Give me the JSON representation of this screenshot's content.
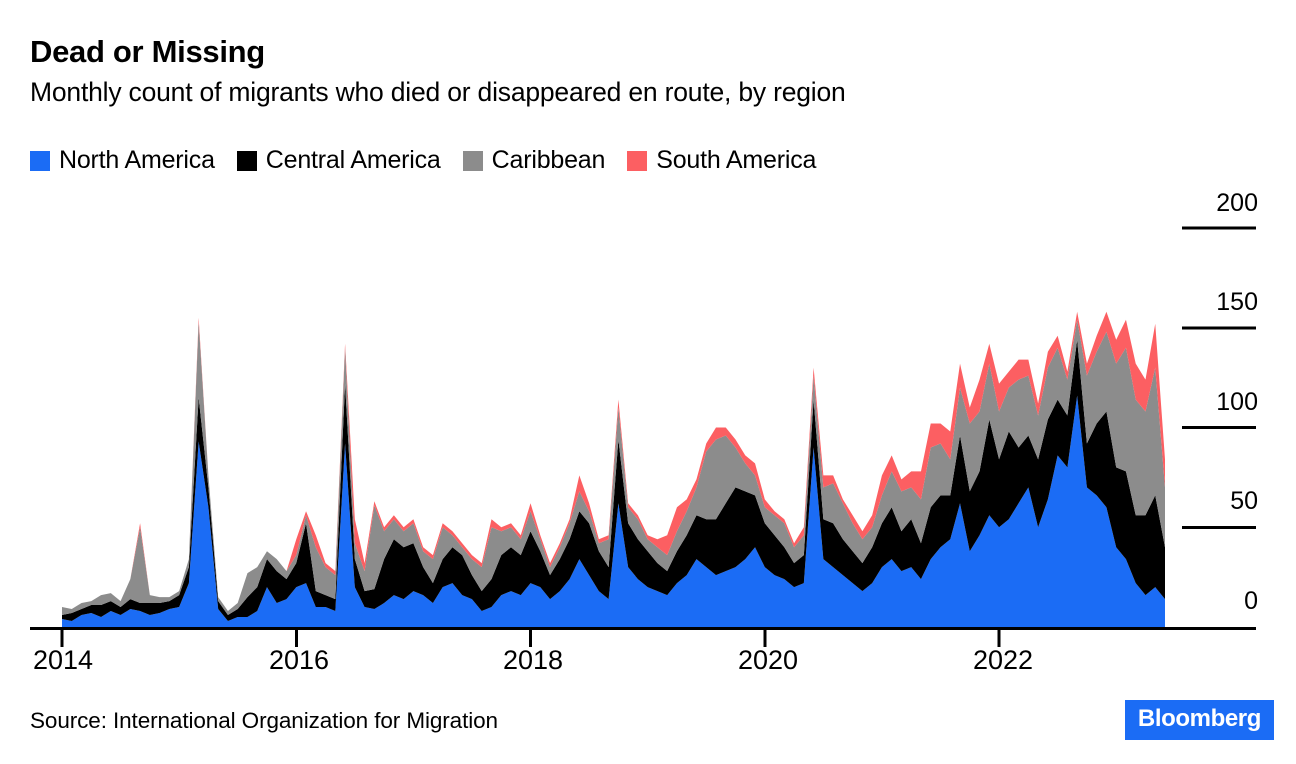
{
  "header": {
    "title": "Dead or Missing",
    "subtitle": "Monthly count of migrants who died or disappeared en route, by region"
  },
  "legend": {
    "items": [
      {
        "label": "North America",
        "color": "#1b6cf5"
      },
      {
        "label": "Central America",
        "color": "#000000"
      },
      {
        "label": "Caribbean",
        "color": "#8c8c8c"
      },
      {
        "label": "South America",
        "color": "#fc5f62"
      }
    ]
  },
  "footer": {
    "source": "Source: International Organization for Migration",
    "brand": "Bloomberg",
    "brand_color": "#1b6cf5"
  },
  "chart_data": {
    "type": "area",
    "stacked": true,
    "title": "Dead or Missing",
    "subtitle": "Monthly count of migrants who died or disappeared en route, by region",
    "xlabel": "",
    "ylabel": "",
    "ylim": [
      0,
      200
    ],
    "yticks": [
      0,
      50,
      100,
      150,
      200
    ],
    "ytick_labels": [
      "0",
      "50",
      "100",
      "150",
      "200"
    ],
    "y_axis_position": "right",
    "grid": false,
    "legend_position": "top-left",
    "xticks": [
      "2014",
      "2016",
      "2018",
      "2020",
      "2022"
    ],
    "xtick_months": [
      "2014-01",
      "2016-01",
      "2018-01",
      "2020-01",
      "2022-01"
    ],
    "x_start": "2014-01",
    "x_end": "2023-06",
    "x": [
      "2014-01",
      "2014-02",
      "2014-03",
      "2014-04",
      "2014-05",
      "2014-06",
      "2014-07",
      "2014-08",
      "2014-09",
      "2014-10",
      "2014-11",
      "2014-12",
      "2015-01",
      "2015-02",
      "2015-03",
      "2015-04",
      "2015-05",
      "2015-06",
      "2015-07",
      "2015-08",
      "2015-09",
      "2015-10",
      "2015-11",
      "2015-12",
      "2016-01",
      "2016-02",
      "2016-03",
      "2016-04",
      "2016-05",
      "2016-06",
      "2016-07",
      "2016-08",
      "2016-09",
      "2016-10",
      "2016-11",
      "2016-12",
      "2017-01",
      "2017-02",
      "2017-03",
      "2017-04",
      "2017-05",
      "2017-06",
      "2017-07",
      "2017-08",
      "2017-09",
      "2017-10",
      "2017-11",
      "2017-12",
      "2018-01",
      "2018-02",
      "2018-03",
      "2018-04",
      "2018-05",
      "2018-06",
      "2018-07",
      "2018-08",
      "2018-09",
      "2018-10",
      "2018-11",
      "2018-12",
      "2019-01",
      "2019-02",
      "2019-03",
      "2019-04",
      "2019-05",
      "2019-06",
      "2019-07",
      "2019-08",
      "2019-09",
      "2019-10",
      "2019-11",
      "2019-12",
      "2020-01",
      "2020-02",
      "2020-03",
      "2020-04",
      "2020-05",
      "2020-06",
      "2020-07",
      "2020-08",
      "2020-09",
      "2020-10",
      "2020-11",
      "2020-12",
      "2021-01",
      "2021-02",
      "2021-03",
      "2021-04",
      "2021-05",
      "2021-06",
      "2021-07",
      "2021-08",
      "2021-09",
      "2021-10",
      "2021-11",
      "2021-12",
      "2022-01",
      "2022-02",
      "2022-03",
      "2022-04",
      "2022-05",
      "2022-06",
      "2022-07",
      "2022-08",
      "2022-09",
      "2022-10",
      "2022-11",
      "2022-12",
      "2023-01",
      "2023-02",
      "2023-03",
      "2023-04",
      "2023-05",
      "2023-06"
    ],
    "series": [
      {
        "name": "North America",
        "color": "#1b6cf5",
        "values": [
          4,
          3,
          6,
          7,
          5,
          8,
          6,
          9,
          8,
          6,
          7,
          9,
          10,
          22,
          93,
          60,
          9,
          3,
          5,
          5,
          8,
          20,
          12,
          14,
          20,
          22,
          10,
          10,
          8,
          92,
          20,
          10,
          9,
          12,
          16,
          14,
          18,
          16,
          12,
          20,
          22,
          16,
          14,
          8,
          10,
          16,
          18,
          16,
          22,
          20,
          14,
          18,
          24,
          34,
          26,
          18,
          14,
          62,
          30,
          24,
          20,
          18,
          16,
          22,
          26,
          34,
          30,
          26,
          28,
          30,
          34,
          40,
          30,
          26,
          24,
          20,
          22,
          90,
          34,
          30,
          26,
          22,
          18,
          22,
          30,
          34,
          28,
          30,
          24,
          34,
          40,
          44,
          62,
          38,
          46,
          56,
          50,
          54,
          62,
          70,
          50,
          64,
          86,
          80,
          116,
          70,
          66,
          60,
          40,
          34,
          22,
          16,
          20,
          14
        ]
      },
      {
        "name": "Central America",
        "color": "#000000",
        "values": [
          2,
          4,
          3,
          4,
          6,
          5,
          4,
          5,
          4,
          6,
          5,
          4,
          6,
          8,
          22,
          10,
          4,
          3,
          4,
          10,
          12,
          14,
          16,
          10,
          12,
          30,
          8,
          6,
          6,
          30,
          14,
          8,
          10,
          22,
          28,
          26,
          24,
          14,
          10,
          14,
          18,
          20,
          12,
          10,
          14,
          20,
          22,
          20,
          26,
          18,
          12,
          16,
          20,
          24,
          26,
          20,
          16,
          32,
          22,
          20,
          18,
          14,
          12,
          16,
          20,
          22,
          24,
          28,
          34,
          40,
          34,
          26,
          22,
          20,
          16,
          12,
          14,
          24,
          20,
          22,
          18,
          16,
          14,
          18,
          22,
          26,
          20,
          24,
          18,
          26,
          26,
          22,
          34,
          30,
          32,
          48,
          34,
          44,
          28,
          26,
          34,
          40,
          28,
          26,
          28,
          22,
          36,
          48,
          40,
          44,
          34,
          40,
          46,
          26
        ]
      },
      {
        "name": "Caribbean",
        "color": "#8c8c8c",
        "values": [
          4,
          2,
          3,
          2,
          5,
          4,
          3,
          10,
          38,
          4,
          3,
          2,
          2,
          4,
          38,
          6,
          2,
          2,
          3,
          12,
          10,
          4,
          6,
          4,
          4,
          4,
          22,
          14,
          12,
          18,
          8,
          10,
          42,
          14,
          10,
          8,
          10,
          8,
          12,
          16,
          6,
          4,
          8,
          12,
          26,
          12,
          10,
          8,
          10,
          6,
          4,
          6,
          8,
          10,
          6,
          4,
          14,
          16,
          8,
          10,
          6,
          8,
          8,
          10,
          12,
          14,
          34,
          40,
          34,
          20,
          14,
          10,
          8,
          10,
          12,
          8,
          10,
          12,
          16,
          20,
          18,
          14,
          12,
          10,
          14,
          18,
          20,
          16,
          22,
          30,
          26,
          18,
          24,
          34,
          30,
          28,
          24,
          22,
          34,
          30,
          22,
          26,
          26,
          18,
          10,
          34,
          36,
          40,
          52,
          62,
          58,
          52,
          64,
          30
        ]
      },
      {
        "name": "South America",
        "color": "#fc5f62",
        "values": [
          0,
          0,
          0,
          0,
          0,
          0,
          0,
          0,
          2,
          0,
          0,
          0,
          0,
          0,
          2,
          0,
          0,
          0,
          0,
          0,
          0,
          0,
          0,
          0,
          8,
          2,
          6,
          2,
          2,
          2,
          12,
          4,
          2,
          2,
          2,
          2,
          2,
          2,
          2,
          2,
          2,
          2,
          2,
          2,
          4,
          2,
          2,
          2,
          4,
          2,
          2,
          2,
          2,
          8,
          4,
          2,
          2,
          4,
          2,
          2,
          2,
          4,
          10,
          12,
          6,
          4,
          4,
          6,
          4,
          4,
          4,
          6,
          4,
          2,
          2,
          2,
          4,
          4,
          6,
          4,
          2,
          4,
          4,
          6,
          10,
          8,
          6,
          8,
          14,
          12,
          10,
          14,
          12,
          8,
          16,
          10,
          14,
          8,
          10,
          8,
          6,
          8,
          6,
          4,
          4,
          6,
          8,
          10,
          12,
          14,
          18,
          16,
          22,
          14
        ]
      }
    ]
  }
}
